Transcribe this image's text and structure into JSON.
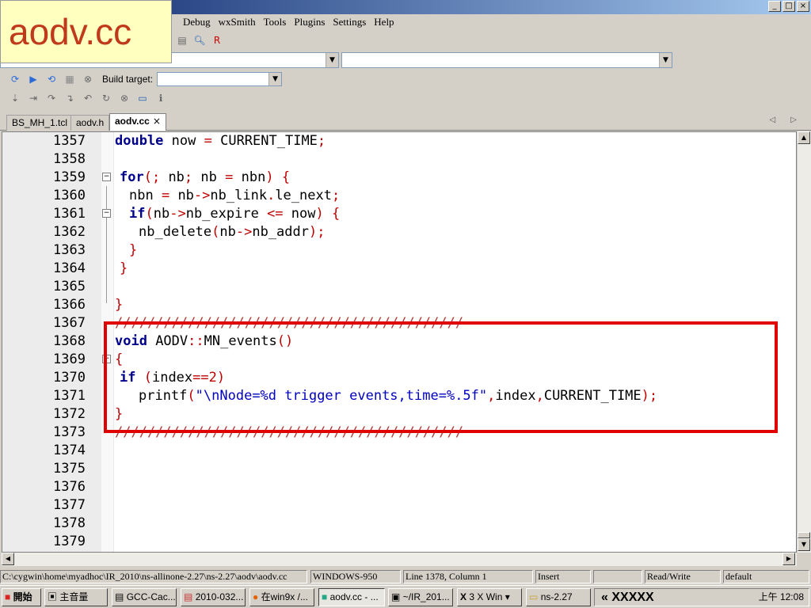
{
  "slide_label": "aodv.cc",
  "window_buttons": [
    "_",
    "□",
    "×"
  ],
  "menu": [
    "Debug",
    "wxSmith",
    "Tools",
    "Plugins",
    "Settings",
    "Help"
  ],
  "toolbar": {
    "build_target_label": "Build target:"
  },
  "tabs": [
    {
      "label": "BS_MH_1.tcl",
      "active": false
    },
    {
      "label": "aodv.h",
      "active": false
    },
    {
      "label": "aodv.cc",
      "active": true,
      "close": "×"
    }
  ],
  "tab_nav": "◁ ▷",
  "editor": {
    "lines": [
      {
        "num": "1357"
      },
      {
        "num": "1358"
      },
      {
        "num": "1359"
      },
      {
        "num": "1360"
      },
      {
        "num": "1361"
      },
      {
        "num": "1362"
      },
      {
        "num": "1363"
      },
      {
        "num": "1364"
      },
      {
        "num": "1365"
      },
      {
        "num": "1366"
      },
      {
        "num": "1367"
      },
      {
        "num": "1368"
      },
      {
        "num": "1369"
      },
      {
        "num": "1370"
      },
      {
        "num": "1371"
      },
      {
        "num": "1372"
      },
      {
        "num": "1373"
      },
      {
        "num": "1374"
      },
      {
        "num": "1375"
      },
      {
        "num": "1376"
      },
      {
        "num": "1377"
      },
      {
        "num": "1378"
      },
      {
        "num": "1379"
      }
    ],
    "code": {
      "l1357": [
        "double",
        " now ",
        "=",
        " CURRENT_TIME",
        ";"
      ],
      "l1359": [
        "for",
        "(;",
        " nb",
        ";",
        " nb ",
        "=",
        " nbn",
        ")",
        " {"
      ],
      "l1360": [
        "nbn ",
        "=",
        " nb",
        "->",
        "nb_link",
        ".",
        "le_next",
        ";"
      ],
      "l1361": [
        "if",
        "(",
        "nb",
        "->",
        "nb_expire ",
        "<=",
        " now",
        ")",
        " {"
      ],
      "l1362": [
        "nb_delete",
        "(",
        "nb",
        "->",
        "nb_addr",
        ");"
      ],
      "l1363": "}",
      "l1364": "}",
      "l1366": "}",
      "l1367": "///////////////////////////////////////////",
      "l1368": [
        "void",
        " AODV",
        "::",
        "MN_events",
        "()"
      ],
      "l1369": "{",
      "l1370": [
        "if",
        " (",
        "index",
        "==",
        "2",
        ")"
      ],
      "l1371": [
        "printf",
        "(",
        "\"\\nNode=%d trigger events,time=%.5f\"",
        ",",
        "index",
        ",",
        "CURRENT_TIME",
        ");"
      ],
      "l1372": "}",
      "l1373": "///////////////////////////////////////////"
    }
  },
  "status": {
    "path": "C:\\cygwin\\home\\myadhoc\\IR_2010\\ns-allinone-2.27\\ns-2.27\\aodv\\aodv.cc",
    "encoding": "WINDOWS-950",
    "position": "Line 1378, Column 1",
    "mode": "Insert",
    "blank": "",
    "access": "Read/Write",
    "lang": "default"
  },
  "taskbar": {
    "start": "開始",
    "items": [
      "主音量",
      "GCC-Cac...",
      "2010-032...",
      "在win9x /...",
      "aodv.cc - ...",
      "~/IR_201...",
      "3 X Win",
      "ns-2.27"
    ],
    "tray_text": "« XXXXX",
    "clock": "上午 12:08"
  }
}
